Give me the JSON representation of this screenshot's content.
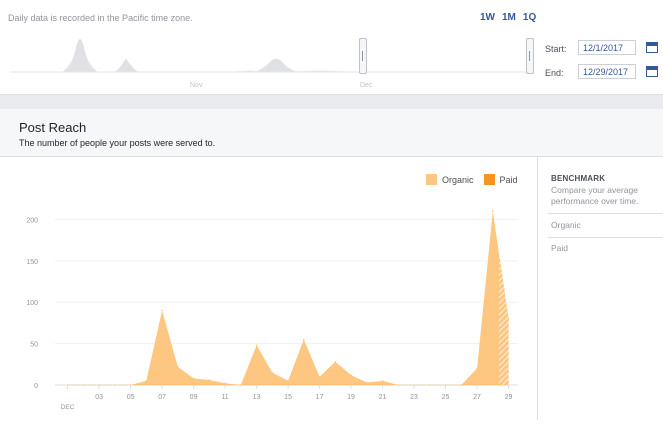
{
  "header": {
    "note": "Daily data is recorded in the Pacific time zone.",
    "ranges": [
      "1W",
      "1M",
      "1Q"
    ],
    "minimap_labels": [
      "Nov",
      "Dec"
    ],
    "start_label": "Start:",
    "start_value": "12/1/2017",
    "end_label": "End:",
    "end_value": "12/29/2017"
  },
  "section": {
    "title": "Post Reach",
    "subtitle": "The number of people your posts were served to."
  },
  "legend": {
    "organic": "Organic",
    "paid": "Paid"
  },
  "benchmark": {
    "heading": "BENCHMARK",
    "description": "Compare your average performance over time.",
    "organic": "Organic",
    "paid": "Paid"
  },
  "colors": {
    "organic": "#fdc681",
    "paid": "#f7931e",
    "link": "#365899"
  },
  "chart_data": {
    "type": "area",
    "x": [
      1,
      2,
      3,
      4,
      5,
      6,
      7,
      8,
      9,
      10,
      11,
      12,
      13,
      14,
      15,
      16,
      17,
      18,
      19,
      20,
      21,
      22,
      23,
      24,
      25,
      26,
      27,
      28,
      29
    ],
    "x_tick_labels": [
      "03",
      "05",
      "07",
      "09",
      "11",
      "13",
      "15",
      "17",
      "19",
      "21",
      "23",
      "25",
      "27",
      "29"
    ],
    "x_tick_values": [
      3,
      5,
      7,
      9,
      11,
      13,
      15,
      17,
      19,
      21,
      23,
      25,
      27,
      29
    ],
    "x_month_label": "DEC",
    "y_tick_labels": [
      "0",
      "50",
      "100",
      "150",
      "200"
    ],
    "ylim": [
      0,
      215
    ],
    "series": [
      {
        "name": "Organic",
        "values": [
          0,
          0,
          0,
          0,
          0,
          5,
          90,
          22,
          8,
          6,
          2,
          0,
          48,
          15,
          5,
          55,
          10,
          28,
          12,
          3,
          5,
          0,
          0,
          0,
          0,
          0,
          20,
          210,
          80
        ]
      },
      {
        "name": "Paid",
        "values": [
          0,
          0,
          0,
          0,
          0,
          0,
          0,
          0,
          0,
          0,
          0,
          0,
          0,
          0,
          0,
          0,
          0,
          0,
          0,
          0,
          0,
          0,
          0,
          0,
          0,
          0,
          0,
          0,
          0
        ]
      }
    ],
    "legend_position": "top-right"
  }
}
